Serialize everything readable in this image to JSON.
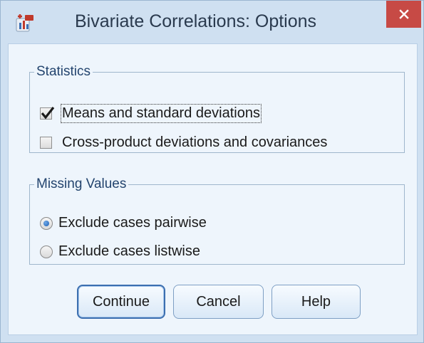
{
  "window": {
    "title": "Bivariate Correlations: Options",
    "close_icon": "close-icon",
    "app_icon": "spss-app-icon"
  },
  "statistics": {
    "legend": "Statistics",
    "options": [
      {
        "label": "Means and standard deviations",
        "checked": true
      },
      {
        "label": "Cross-product deviations and covariances",
        "checked": false
      }
    ]
  },
  "missing_values": {
    "legend": "Missing Values",
    "options": [
      {
        "label": "Exclude cases pairwise",
        "selected": true
      },
      {
        "label": "Exclude cases listwise",
        "selected": false
      }
    ]
  },
  "buttons": {
    "continue": "Continue",
    "cancel": "Cancel",
    "help": "Help"
  },
  "colors": {
    "titlebar": "#cfe0f1",
    "close_button": "#c74a45",
    "client_bg": "#eef5fc",
    "legend_text": "#23446e"
  }
}
